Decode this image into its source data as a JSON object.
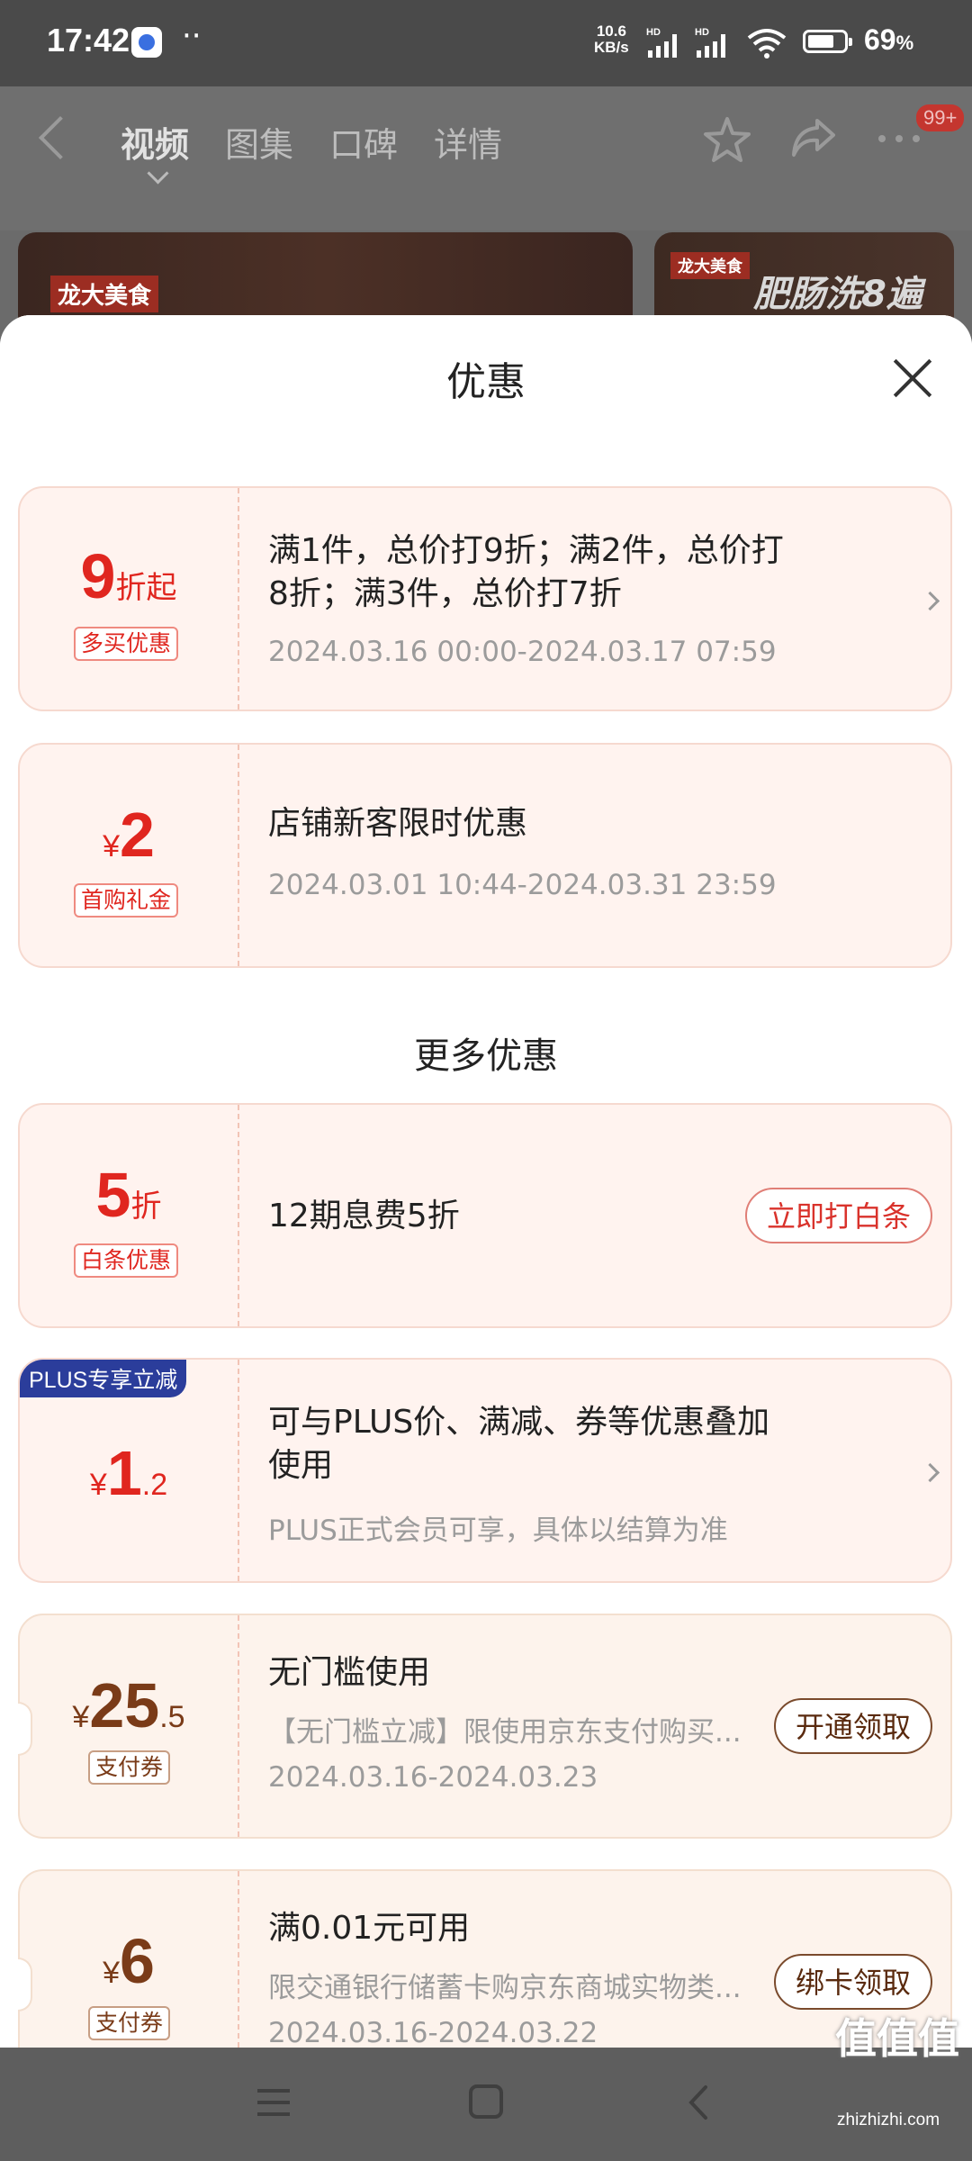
{
  "status_bar": {
    "time": "17:42",
    "dots": "··",
    "net_speed": "10.6",
    "net_unit": "KB/s",
    "battery": "69",
    "battery_unit": "%"
  },
  "nav": {
    "tabs": [
      {
        "label": "视频",
        "active": true
      },
      {
        "label": "图集"
      },
      {
        "label": "口碑"
      },
      {
        "label": "详情"
      }
    ],
    "badge": "99+"
  },
  "banners": {
    "left_logo": "龙大美食",
    "right_logo": "龙大美食",
    "right_slogan": "肥肠洗8遍"
  },
  "sheet": {
    "title": "优惠",
    "more_title": "更多优惠"
  },
  "offers": [
    {
      "value": "9",
      "value_suffix": "折起",
      "tag": "多买优惠",
      "title_lines": [
        "满1件，总价打9折；满2件，总价打",
        "8折；满3件，总价打7折"
      ],
      "subtitle": "2024.03.16 00:00-2024.03.17 07:59"
    },
    {
      "currency": "¥",
      "value": "2",
      "tag": "首购礼金",
      "title": "店铺新客限时优惠",
      "subtitle": "2024.03.01 10:44-2024.03.31 23:59"
    },
    {
      "value": "5",
      "value_suffix": "折",
      "tag": "白条优惠",
      "title": "12期息费5折",
      "action": "立即打白条"
    },
    {
      "badge": "PLUS专享立减",
      "currency": "¥",
      "value": "1",
      "value_decimal": ".2",
      "title_lines": [
        "可与PLUS价、满减、券等优惠叠加",
        "使用"
      ],
      "subtitle": "PLUS正式会员可享，具体以结算为准"
    },
    {
      "currency": "¥",
      "value": "25",
      "value_decimal": ".5",
      "tag": "支付券",
      "title": "无门槛使用",
      "desc": "【无门槛立减】限使用京东支付购买...",
      "subtitle": "2024.03.16-2024.03.23",
      "action": "开通领取"
    },
    {
      "currency": "¥",
      "value": "6",
      "tag": "支付券",
      "title": "满0.01元可用",
      "desc": "限交通银行储蓄卡购京东商城实物类...",
      "subtitle": "2024.03.16-2024.03.22",
      "action": "绑卡领取"
    }
  ],
  "watermark": {
    "main": "值值值",
    "sub": "zhizhizhi.com"
  },
  "colors": {
    "accent_red": "#e0261f",
    "coupon_brown": "#7a3b18",
    "plus_blue": "#2b3d9b"
  }
}
